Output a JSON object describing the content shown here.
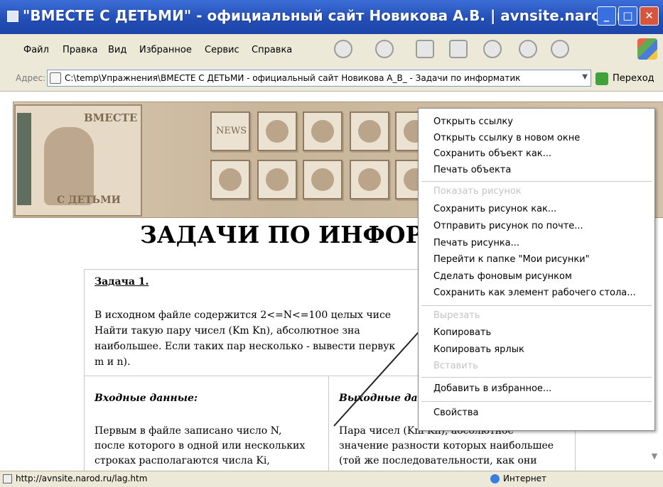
{
  "window": {
    "title": "\"ВМЕСТЕ С ДЕТЬМИ\" - официальный сайт Новикова А.В. | avnsite.narod.r...",
    "minimize": "_",
    "maximize": "□",
    "close": "✕"
  },
  "menu": [
    "Файл",
    "Правка",
    "Вид",
    "Избранное",
    "Сервис",
    "Справка"
  ],
  "toolbar_icons": [
    "back-icon",
    "forward-icon",
    "stop-icon",
    "refresh-icon",
    "home-icon",
    "search-icon",
    "favorites-icon"
  ],
  "address": {
    "label": "Адрес:",
    "value": "C:\\temp\\Упражнения\\ВМЕСТЕ С ДЕТЬМИ - официальный сайт Новикова А_В_ - Задачи по информатик",
    "go_label": "Переход"
  },
  "site": {
    "logo_top": "ВМЕСТЕ",
    "logo_bottom": "С ДЕТЬМИ",
    "nav_news": "NEWS"
  },
  "page": {
    "heading": "ЗАДАЧИ ПО ИНФОРМ",
    "task_title": "Задача 1.",
    "task_lines": [
      "В исходном файле содержится 2<=N<=100 целых чисе",
      "Найти такую пару чисел (Km Kn), абсолютное зна",
      "наибольшее. Если таких пар несколько - вывести первук",
      "m и n)."
    ],
    "input_heading": "Входные данные:",
    "input_lines": [
      "Первым в файле записано число N,",
      "после которого в одной или нескольких",
      "строках располагаются числа Ki,"
    ],
    "output_heading": "Выходные да",
    "output_lines": [
      "Пара чисел (Km Kn), абсолютное",
      "значение разности которых наибольшее",
      "(той же последовательности, как они"
    ]
  },
  "context_menu": {
    "group1": [
      "Открыть ссылку",
      "Открыть ссылку в новом окне",
      "Сохранить объект как...",
      "Печать объекта"
    ],
    "disabled1": "Показать рисунок",
    "group2": [
      "Сохранить рисунок как...",
      "Отправить рисунок по почте...",
      "Печать рисунка...",
      "Перейти к папке \"Мои рисунки\"",
      "Сделать фоновым рисунком",
      "Сохранить как элемент рабочего стола..."
    ],
    "disabled2": "Вырезать",
    "group3": [
      "Копировать",
      "Копировать ярлык"
    ],
    "disabled3": "Вставить",
    "favorites": "Добавить в избранное...",
    "properties": "Свойства"
  },
  "status": {
    "url": "http://avnsite.narod.ru/lag.htm",
    "zone": "Интернет"
  }
}
